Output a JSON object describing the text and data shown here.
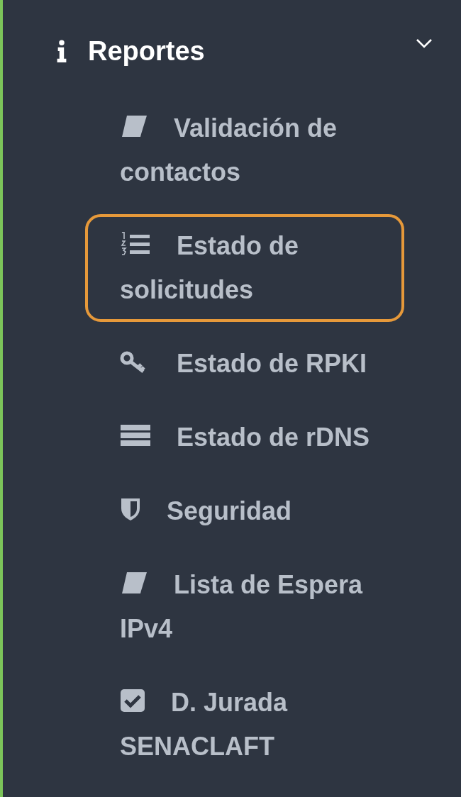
{
  "section": {
    "title": "Reportes",
    "expanded": true
  },
  "items": [
    {
      "label": "Validación de contactos",
      "selected": false
    },
    {
      "label": "Estado de solicitudes",
      "selected": true
    },
    {
      "label": "Estado de RPKI",
      "selected": false
    },
    {
      "label": "Estado de rDNS",
      "selected": false
    },
    {
      "label": "Seguridad",
      "selected": false
    },
    {
      "label": "Lista de Espera IPv4",
      "selected": false
    },
    {
      "label": "D. Jurada SENACLAFT",
      "selected": false
    }
  ]
}
